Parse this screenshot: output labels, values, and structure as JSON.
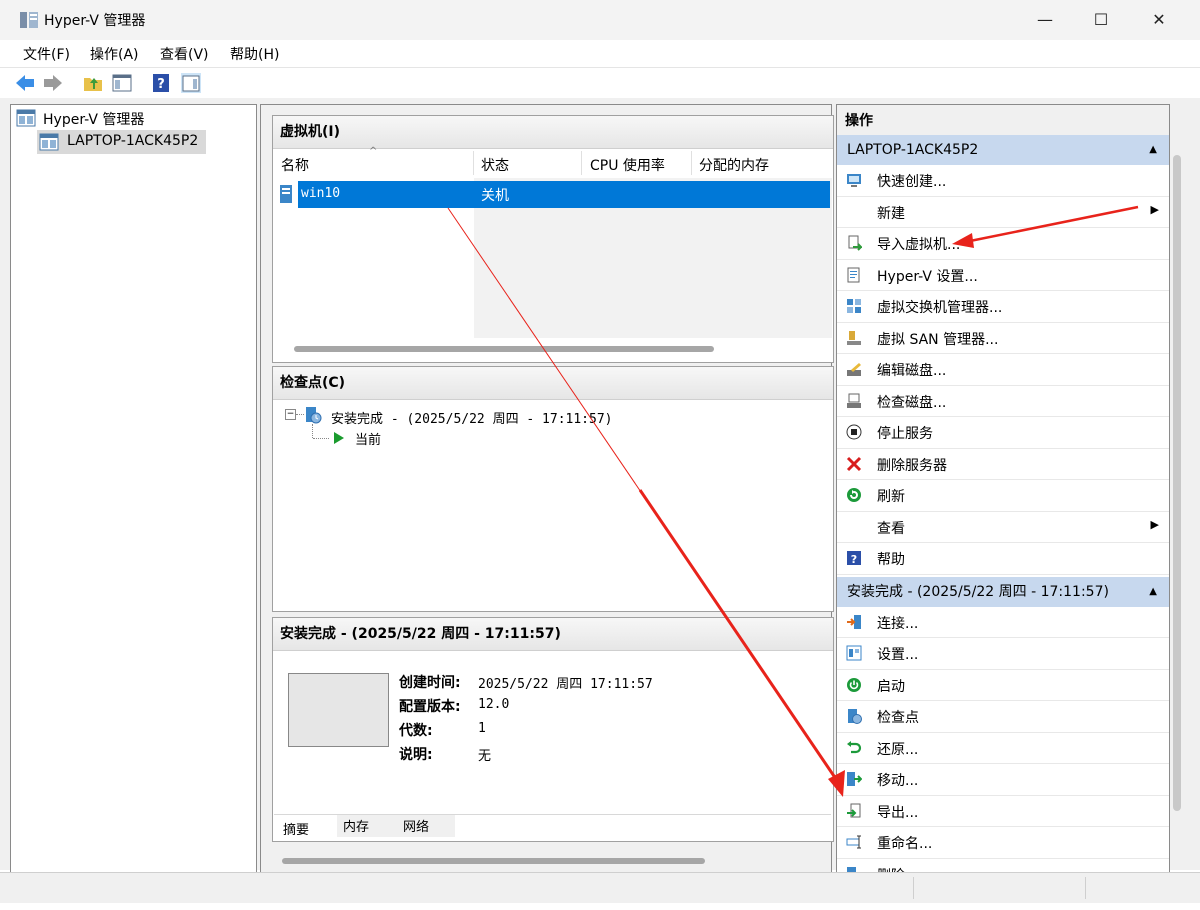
{
  "window": {
    "title": "Hyper-V 管理器",
    "minimize": "—",
    "maximize": "☐",
    "close": "✕"
  },
  "menu": {
    "file": "文件(F)",
    "action": "操作(A)",
    "view": "查看(V)",
    "help": "帮助(H)"
  },
  "tree": {
    "root": "Hyper-V 管理器",
    "host": "LAPTOP-1ACK45P2"
  },
  "vm_panel": {
    "title": "虚拟机(I)",
    "columns": {
      "name": "名称",
      "state": "状态",
      "cpu": "CPU 使用率",
      "memory": "分配的内存"
    },
    "rows": [
      {
        "name": "win10",
        "state": "关机"
      }
    ]
  },
  "checkpoint_panel": {
    "title": "检查点(C)",
    "item": "安装完成 - (2025/5/22 周四 - 17:11:57)",
    "current": "当前"
  },
  "details_panel": {
    "title": "安装完成 - (2025/5/22 周四 - 17:11:57)",
    "fields": [
      {
        "label": "创建时间:",
        "value": "2025/5/22 周四 17:11:57"
      },
      {
        "label": "配置版本:",
        "value": "12.0"
      },
      {
        "label": "代数:",
        "value": "1"
      },
      {
        "label": "说明:",
        "value": "无"
      }
    ],
    "tabs": {
      "summary": "摘要",
      "memory": "内存",
      "network": "网络"
    }
  },
  "actions": {
    "title": "操作",
    "host_section": "LAPTOP-1ACK45P2",
    "host_items": {
      "quick_create": "快速创建...",
      "new": "新建",
      "import_vm": "导入虚拟机...",
      "hyperv_settings": "Hyper-V 设置...",
      "vswitch_mgr": "虚拟交换机管理器...",
      "vsan_mgr": "虚拟 SAN 管理器...",
      "edit_disk": "编辑磁盘...",
      "inspect_disk": "检查磁盘...",
      "stop_service": "停止服务",
      "remove_server": "删除服务器",
      "refresh": "刷新",
      "view": "查看",
      "help": "帮助"
    },
    "checkpoint_section": "安装完成 - (2025/5/22 周四 - 17:11:57)",
    "checkpoint_items": {
      "connect": "连接...",
      "settings": "设置...",
      "start": "启动",
      "checkpoint": "检查点",
      "revert": "还原...",
      "move": "移动...",
      "export": "导出...",
      "rename": "重命名...",
      "delete": "删除..."
    }
  },
  "colors": {
    "selection": "#0078d7",
    "action_header": "#c7d8ee",
    "annotation_arrow": "#e8231b"
  }
}
